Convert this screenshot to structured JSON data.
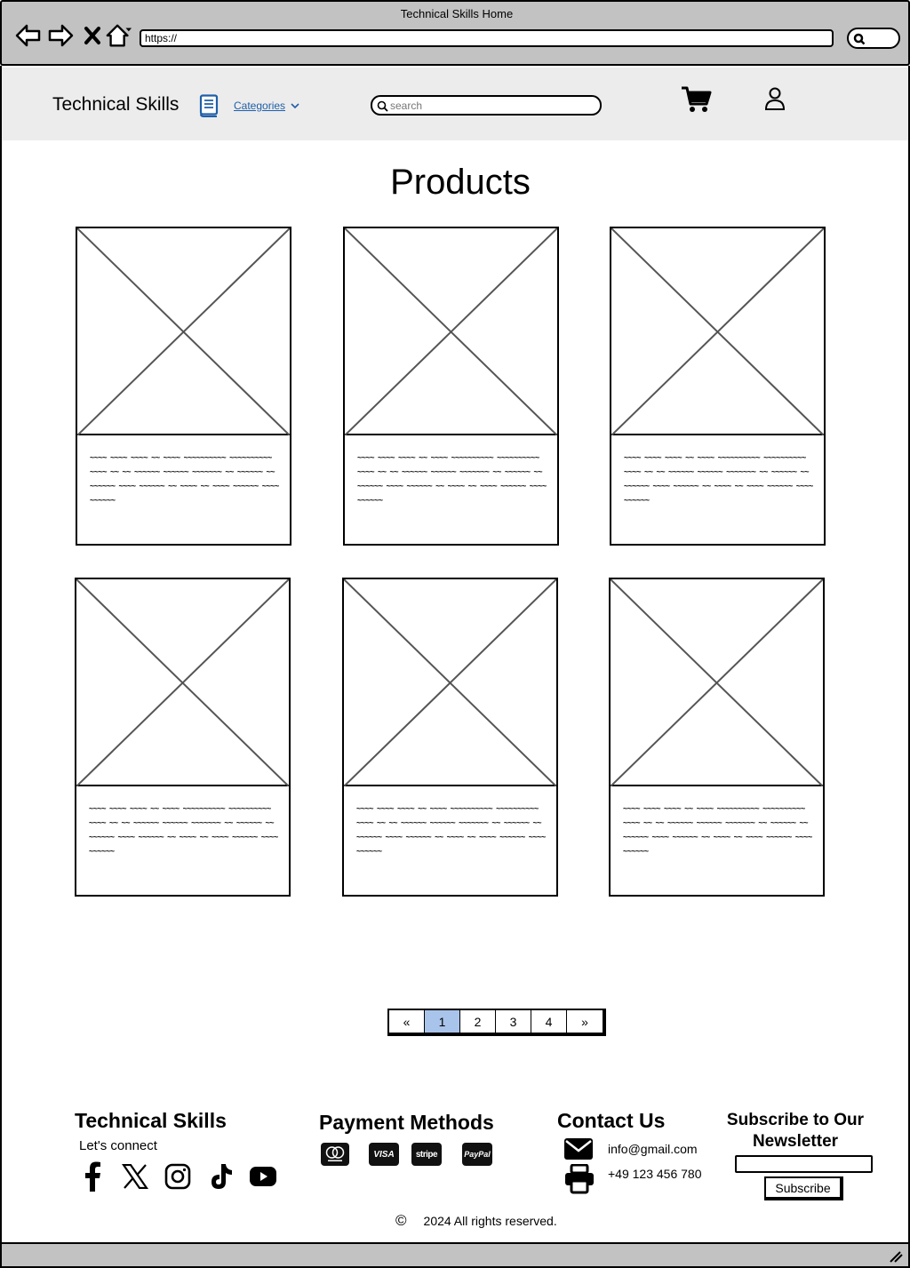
{
  "browser": {
    "window_title": "Technical Skills Home",
    "url": "https://"
  },
  "header": {
    "brand": "Technical Skills",
    "categories_label": "Categories",
    "search_placeholder": "search"
  },
  "main": {
    "title": "Products",
    "products": [
      {
        "description": "~~~~ ~~~~ ~~~~ ~~ ~~~~ ~~~~~~~~~~ ~~~~~~~~~~ ~~~~ ~~ ~~ ~~~~~~ ~~~~~~ ~~~~~~~ ~~ ~~~~~~ ~~ ~~~~~~ ~~~~ ~~~~~~ ~~ ~~~~ ~~ ~~~~ ~~~~~~ ~~~~ ~~~~~~"
      },
      {
        "description": "~~~~ ~~~~ ~~~~ ~~ ~~~~ ~~~~~~~~~~ ~~~~~~~~~~ ~~~~ ~~ ~~ ~~~~~~ ~~~~~~ ~~~~~~~ ~~ ~~~~~~ ~~ ~~~~~~ ~~~~ ~~~~~~ ~~ ~~~~ ~~ ~~~~ ~~~~~~ ~~~~ ~~~~~~"
      },
      {
        "description": "~~~~ ~~~~ ~~~~ ~~ ~~~~ ~~~~~~~~~~ ~~~~~~~~~~ ~~~~ ~~ ~~ ~~~~~~ ~~~~~~ ~~~~~~~ ~~ ~~~~~~ ~~ ~~~~~~ ~~~~ ~~~~~~ ~~ ~~~~ ~~ ~~~~ ~~~~~~ ~~~~ ~~~~~~"
      },
      {
        "description": "~~~~ ~~~~ ~~~~ ~~ ~~~~ ~~~~~~~~~~ ~~~~~~~~~~ ~~~~ ~~ ~~ ~~~~~~ ~~~~~~ ~~~~~~~ ~~ ~~~~~~ ~~ ~~~~~~ ~~~~ ~~~~~~ ~~ ~~~~ ~~ ~~~~ ~~~~~~ ~~~~ ~~~~~~"
      },
      {
        "description": "~~~~ ~~~~ ~~~~ ~~ ~~~~ ~~~~~~~~~~ ~~~~~~~~~~ ~~~~ ~~ ~~ ~~~~~~ ~~~~~~ ~~~~~~~ ~~ ~~~~~~ ~~ ~~~~~~ ~~~~ ~~~~~~ ~~ ~~~~ ~~ ~~~~ ~~~~~~ ~~~~ ~~~~~~"
      },
      {
        "description": "~~~~ ~~~~ ~~~~ ~~ ~~~~ ~~~~~~~~~~ ~~~~~~~~~~ ~~~~ ~~ ~~ ~~~~~~ ~~~~~~ ~~~~~~~ ~~ ~~~~~~ ~~ ~~~~~~ ~~~~ ~~~~~~ ~~ ~~~~ ~~ ~~~~ ~~~~~~ ~~~~ ~~~~~~"
      }
    ]
  },
  "pagination": {
    "prev": "«",
    "pages": [
      "1",
      "2",
      "3",
      "4"
    ],
    "next": "»",
    "active_page": "1"
  },
  "footer": {
    "brand": "Technical Skills",
    "lets_connect": "Let's connect",
    "social_icons": [
      "facebook-icon",
      "x-icon",
      "instagram-icon",
      "tiktok-icon",
      "youtube-icon"
    ],
    "payment_title": "Payment Methods",
    "payment_methods": [
      "mastercard",
      "VISA",
      "stripe",
      "PayPal"
    ],
    "contact_title": "Contact Us",
    "email": "info@gmail.com",
    "phone": "+49 123 456 780",
    "newsletter_title": "Subscribe to Our Newsletter",
    "subscribe_label": "Subscribe",
    "copyright_symbol": "©",
    "copyright_text": "2024 All rights reserved."
  },
  "colors": {
    "chrome_gray": "#c2c2c2",
    "header_bg": "#ececec",
    "link_blue": "#1f5fa8",
    "active_page": "#a9c4eb"
  }
}
